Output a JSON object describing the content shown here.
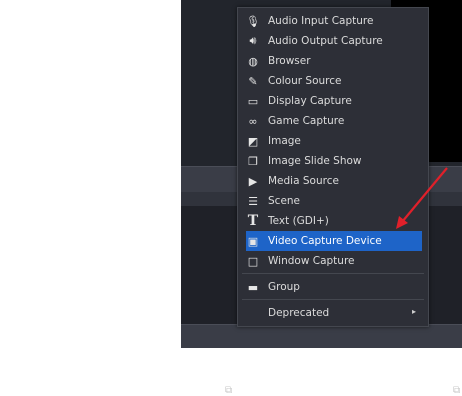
{
  "menu": {
    "items": [
      {
        "label": "Audio Input Capture",
        "icon": "microphone-icon"
      },
      {
        "label": "Audio Output Capture",
        "icon": "speaker-icon"
      },
      {
        "label": "Browser",
        "icon": "globe-icon"
      },
      {
        "label": "Colour Source",
        "icon": "brush-icon"
      },
      {
        "label": "Display Capture",
        "icon": "monitor-icon"
      },
      {
        "label": "Game Capture",
        "icon": "gamepad-icon"
      },
      {
        "label": "Image",
        "icon": "image-icon"
      },
      {
        "label": "Image Slide Show",
        "icon": "slideshow-icon"
      },
      {
        "label": "Media Source",
        "icon": "play-icon"
      },
      {
        "label": "Scene",
        "icon": "list-icon"
      },
      {
        "label": "Text (GDI+)",
        "icon": "text-icon"
      },
      {
        "label": "Video Capture Device",
        "icon": "camera-icon",
        "selected": true
      },
      {
        "label": "Window Capture",
        "icon": "window-icon"
      }
    ],
    "group": {
      "label": "Group",
      "icon": "folder-icon"
    },
    "deprecated": {
      "label": "Deprecated",
      "icon": "chevron-right-icon"
    }
  },
  "toolbar": {
    "settings_icon": "gear-icon"
  },
  "colors": {
    "menu_bg": "#2d2f37",
    "selection": "#1e64c8",
    "arrow": "#e0202a"
  }
}
